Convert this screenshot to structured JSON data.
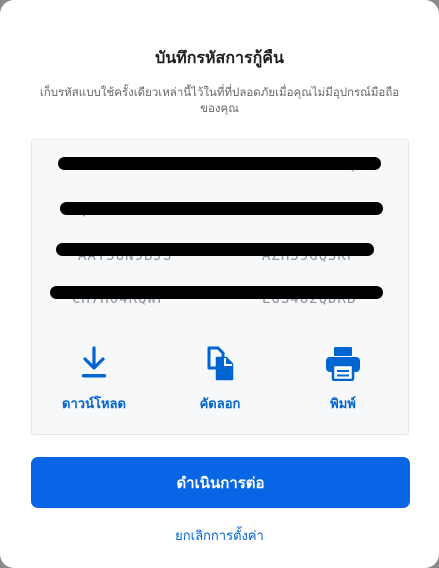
{
  "dialog": {
    "title": "บันทึกรหัสการกู้คืน",
    "subtitle": "เก็บรหัสแบบใช้ครั้งเดียวเหล่านี้ไว้ในที่ที่ปลอดภัยเมื่อคุณไม่มีอุปกรณ์มือถือของคุณ"
  },
  "codes": [
    {
      "left": "D7ASFSPEXR",
      "right": "KDUW6P39VQ"
    },
    {
      "left": "QETD6M1KD5",
      "right": "YER1SSKHWG"
    },
    {
      "left": "AAY5UN9BJS",
      "right": "AZH39GQ5KP"
    },
    {
      "left": "CH7H04RQWF",
      "right": "E6S4U2QDRB"
    }
  ],
  "actions": {
    "download": {
      "label": "ดาวน์โหลด",
      "icon": "download-icon"
    },
    "copy": {
      "label": "คัดลอก",
      "icon": "copy-icon"
    },
    "print": {
      "label": "พิมพ์",
      "icon": "printer-icon"
    }
  },
  "buttons": {
    "continue_label": "ดำเนินการต่อ",
    "cancel_label": "ยกเลิกการตั้งค่า"
  },
  "colors": {
    "accent": "#0866e6",
    "link": "#0064d1"
  }
}
